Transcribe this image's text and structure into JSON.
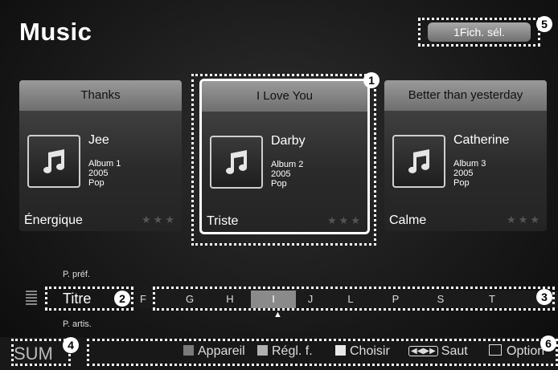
{
  "header": {
    "title": "Music",
    "selection_button": "1Fich. sél."
  },
  "badges": [
    "1",
    "2",
    "3",
    "4",
    "5",
    "6"
  ],
  "cards": [
    {
      "title": "Thanks",
      "artist": "Jee",
      "album": "Album 1",
      "year": "2005",
      "genre": "Pop",
      "mood": "Énergique",
      "stars": "★★★"
    },
    {
      "title": "I Love You",
      "artist": "Darby",
      "album": "Album 2",
      "year": "2005",
      "genre": "Pop",
      "mood": "Triste",
      "stars": "★★★"
    },
    {
      "title": "Better than yesterday",
      "artist": "Catherine",
      "album": "Album 3",
      "year": "2005",
      "genre": "Pop",
      "mood": "Calme",
      "stars": "★★★"
    }
  ],
  "sort": {
    "prev": "P. préf.",
    "current": "Titre",
    "next": "P. artis."
  },
  "letters": [
    "F",
    "G",
    "H",
    "I",
    "J",
    "L",
    "P",
    "S",
    "T"
  ],
  "active_letter": "I",
  "bottom": {
    "logo": "SUM",
    "device": "Appareil",
    "settings": "Régl. f.",
    "choose": "Choisir",
    "skip": "Saut",
    "option": "Option"
  },
  "colors": {
    "device_square": "#7a7a7a",
    "settings_square": "#b0b0b0",
    "choose_square": "#e8e8e8"
  }
}
